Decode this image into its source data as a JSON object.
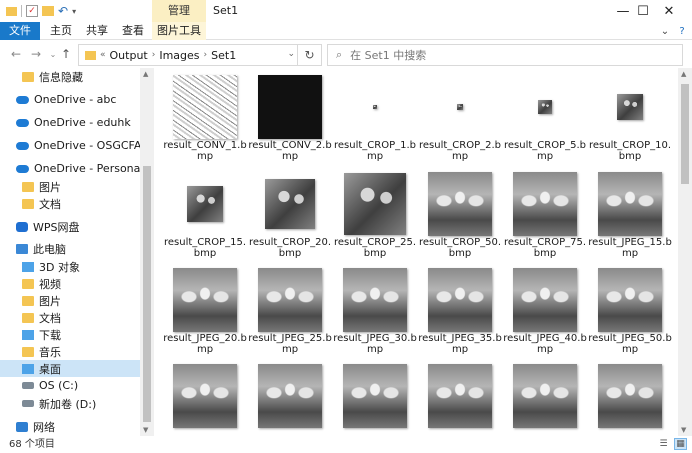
{
  "titlebar": {
    "context_tab": "管理",
    "title": "Set1",
    "minimize_glyph": "—",
    "maximize_glyph": "☐",
    "close_glyph": "✕"
  },
  "ribbon": {
    "tabs": [
      "文件",
      "主页",
      "共享",
      "查看",
      "图片工具"
    ]
  },
  "nav": {
    "breadcrumb": [
      "Output",
      "Images",
      "Set1"
    ],
    "search_placeholder": "在 Set1 中搜索"
  },
  "sidebar": {
    "items": [
      {
        "label": "信息隐藏",
        "icon": "folder-icon"
      },
      {
        "label": "OneDrive - abc",
        "icon": "onedrive-icon"
      },
      {
        "label": "OneDrive - eduhk",
        "icon": "onedrive-icon"
      },
      {
        "label": "OneDrive - OSGCFA",
        "icon": "onedrive-icon"
      },
      {
        "label": "OneDrive - Personal",
        "icon": "onedrive-icon"
      },
      {
        "label": "图片",
        "icon": "folder-icon"
      },
      {
        "label": "文档",
        "icon": "folder-icon"
      },
      {
        "label": "WPS网盘",
        "icon": "wps-cloud-icon"
      },
      {
        "label": "此电脑",
        "icon": "computer-icon"
      },
      {
        "label": "3D 对象",
        "icon": "3d-objects-icon"
      },
      {
        "label": "视频",
        "icon": "videos-icon"
      },
      {
        "label": "图片",
        "icon": "pictures-icon"
      },
      {
        "label": "文档",
        "icon": "documents-icon"
      },
      {
        "label": "下载",
        "icon": "downloads-icon"
      },
      {
        "label": "音乐",
        "icon": "music-icon"
      },
      {
        "label": "桌面",
        "icon": "desktop-icon"
      },
      {
        "label": "OS (C:)",
        "icon": "drive-icon"
      },
      {
        "label": "新加卷 (D:)",
        "icon": "drive-icon"
      },
      {
        "label": "网络",
        "icon": "network-icon"
      }
    ],
    "selected": "桌面"
  },
  "files": [
    {
      "name": "result_CONV_1.bmp",
      "thumb": "conv1"
    },
    {
      "name": "result_CONV_2.bmp",
      "thumb": "conv2"
    },
    {
      "name": "result_CROP_1.bmp",
      "thumb": "cat"
    },
    {
      "name": "result_CROP_2.bmp",
      "thumb": "cat"
    },
    {
      "name": "result_CROP_5.bmp",
      "thumb": "cat"
    },
    {
      "name": "result_CROP_10.bmp",
      "thumb": "cat"
    },
    {
      "name": "result_CROP_15.bmp",
      "thumb": "cat"
    },
    {
      "name": "result_CROP_20.bmp",
      "thumb": "cat"
    },
    {
      "name": "result_CROP_25.bmp",
      "thumb": "cat"
    },
    {
      "name": "result_CROP_50.bmp",
      "thumb": "cats"
    },
    {
      "name": "result_CROP_75.bmp",
      "thumb": "cats"
    },
    {
      "name": "result_JPEG_15.bmp",
      "thumb": "cats"
    },
    {
      "name": "result_JPEG_20.bmp",
      "thumb": "cats"
    },
    {
      "name": "result_JPEG_25.bmp",
      "thumb": "cats"
    },
    {
      "name": "result_JPEG_30.bmp",
      "thumb": "cats"
    },
    {
      "name": "result_JPEG_35.bmp",
      "thumb": "cats"
    },
    {
      "name": "result_JPEG_40.bmp",
      "thumb": "cats"
    },
    {
      "name": "result_JPEG_50.bmp",
      "thumb": "cats"
    },
    {
      "name": "",
      "thumb": "cats"
    },
    {
      "name": "",
      "thumb": "cats"
    },
    {
      "name": "",
      "thumb": "cats"
    },
    {
      "name": "",
      "thumb": "cats"
    },
    {
      "name": "",
      "thumb": "cats"
    },
    {
      "name": "",
      "thumb": "cats"
    }
  ],
  "status": {
    "count": "68 个项目"
  },
  "colors": {
    "accent": "#1979ca",
    "selection": "#cce4f7",
    "context_tab": "#fbefc3"
  }
}
